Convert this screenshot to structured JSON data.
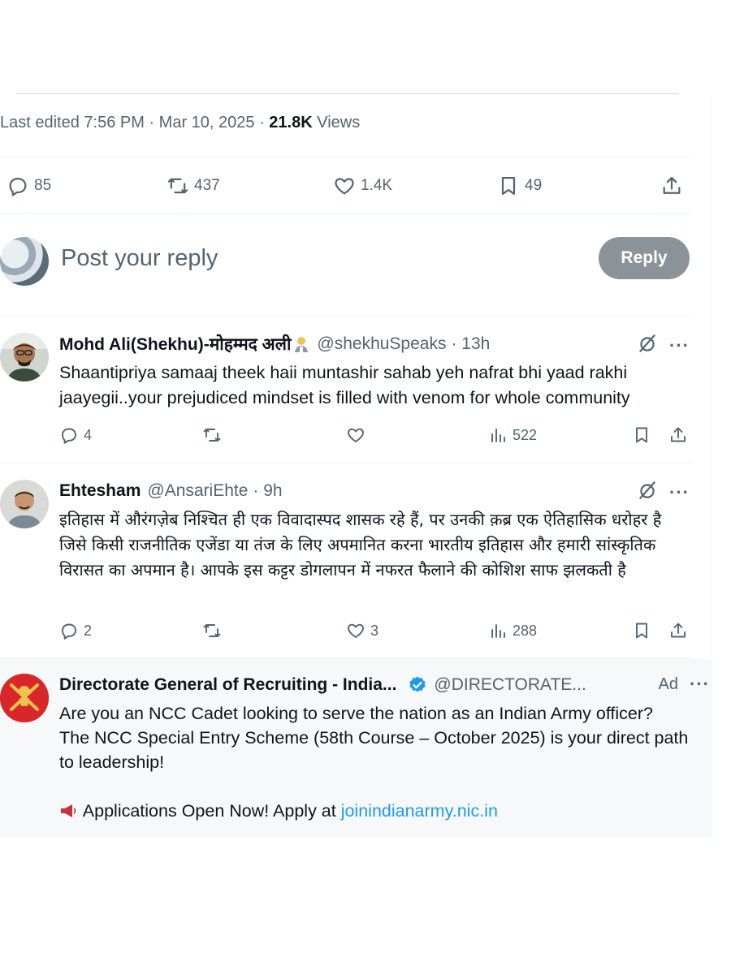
{
  "post_meta": {
    "edited_label": "Last edited 7:56 PM · Mar 10, 2025 · ",
    "views_count": "21.8K",
    "views_label": " Views"
  },
  "post_actions": {
    "replies": "85",
    "reposts": "437",
    "likes": "1.4K",
    "bookmarks": "49"
  },
  "reply_composer": {
    "placeholder": "Post your reply",
    "button_label": "Reply"
  },
  "replies": [
    {
      "name": "Mohd Ali(Shekhu)-मोहम्मद अली",
      "handle": "@shekhuSpeaks",
      "time": "· 13h",
      "text": "Shaantipriya samaaj theek haii muntashir sahab yeh nafrat bhi yaad rakhi jaayegii..your prejudiced mindset is filled with venom for whole community",
      "replies": "4",
      "reposts": "",
      "likes": "",
      "views": "522"
    },
    {
      "name": "Ehtesham",
      "handle": "@AnsariEhte",
      "time": "· 9h",
      "text": "इतिहास में औरंगज़ेब निश्चित ही एक विवादास्पद शासक रहे हैं, पर उनकी क़ब्र एक ऐतिहासिक धरोहर है जिसे किसी राजनीतिक एजेंडा या तंज के लिए अपमानित करना भारतीय इतिहास और हमारी सांस्कृतिक विरासत का अपमान है। आपके इस कट्टर डोगलापन में नफरत फैलाने की कोशिश साफ झलकती है",
      "replies": "2",
      "reposts": "",
      "likes": "3",
      "views": "288"
    }
  ],
  "ad": {
    "name": "Directorate General of Recruiting - India...",
    "handle": "@DIRECTORATE...",
    "ad_label": "Ad",
    "line1": "Are you an NCC Cadet looking to serve the nation as an Indian Army officer?",
    "line2": "The NCC Special Entry Scheme (58th Course – October 2025) is your direct path to leadership!",
    "line3_prefix": "Applications Open Now! Apply at ",
    "line3_link": "joinindianarmy.nic.in"
  },
  "colors": {
    "text": "#0f1419",
    "secondary": "#536471",
    "link": "#1d9bf0",
    "reply_button": "#8b9399"
  }
}
